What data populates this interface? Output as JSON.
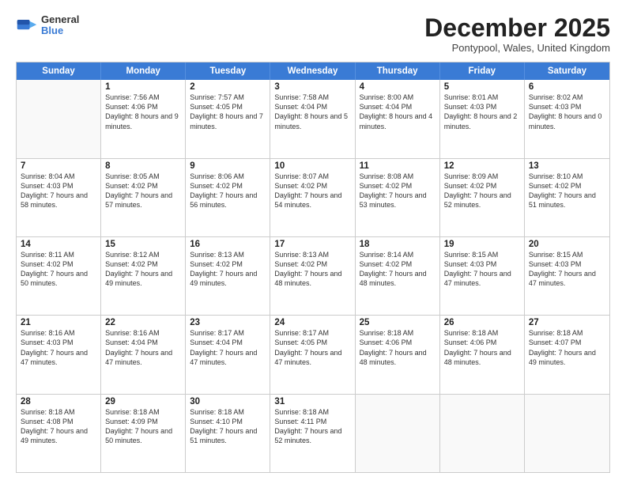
{
  "header": {
    "logo_general": "General",
    "logo_blue": "Blue",
    "month_title": "December 2025",
    "subtitle": "Pontypool, Wales, United Kingdom"
  },
  "day_headers": [
    "Sunday",
    "Monday",
    "Tuesday",
    "Wednesday",
    "Thursday",
    "Friday",
    "Saturday"
  ],
  "weeks": [
    [
      {
        "day": "",
        "info": ""
      },
      {
        "day": "1",
        "info": "Sunrise: 7:56 AM\nSunset: 4:06 PM\nDaylight: 8 hours\nand 9 minutes."
      },
      {
        "day": "2",
        "info": "Sunrise: 7:57 AM\nSunset: 4:05 PM\nDaylight: 8 hours\nand 7 minutes."
      },
      {
        "day": "3",
        "info": "Sunrise: 7:58 AM\nSunset: 4:04 PM\nDaylight: 8 hours\nand 5 minutes."
      },
      {
        "day": "4",
        "info": "Sunrise: 8:00 AM\nSunset: 4:04 PM\nDaylight: 8 hours\nand 4 minutes."
      },
      {
        "day": "5",
        "info": "Sunrise: 8:01 AM\nSunset: 4:03 PM\nDaylight: 8 hours\nand 2 minutes."
      },
      {
        "day": "6",
        "info": "Sunrise: 8:02 AM\nSunset: 4:03 PM\nDaylight: 8 hours\nand 0 minutes."
      }
    ],
    [
      {
        "day": "7",
        "info": "Sunrise: 8:04 AM\nSunset: 4:03 PM\nDaylight: 7 hours\nand 58 minutes."
      },
      {
        "day": "8",
        "info": "Sunrise: 8:05 AM\nSunset: 4:02 PM\nDaylight: 7 hours\nand 57 minutes."
      },
      {
        "day": "9",
        "info": "Sunrise: 8:06 AM\nSunset: 4:02 PM\nDaylight: 7 hours\nand 56 minutes."
      },
      {
        "day": "10",
        "info": "Sunrise: 8:07 AM\nSunset: 4:02 PM\nDaylight: 7 hours\nand 54 minutes."
      },
      {
        "day": "11",
        "info": "Sunrise: 8:08 AM\nSunset: 4:02 PM\nDaylight: 7 hours\nand 53 minutes."
      },
      {
        "day": "12",
        "info": "Sunrise: 8:09 AM\nSunset: 4:02 PM\nDaylight: 7 hours\nand 52 minutes."
      },
      {
        "day": "13",
        "info": "Sunrise: 8:10 AM\nSunset: 4:02 PM\nDaylight: 7 hours\nand 51 minutes."
      }
    ],
    [
      {
        "day": "14",
        "info": "Sunrise: 8:11 AM\nSunset: 4:02 PM\nDaylight: 7 hours\nand 50 minutes."
      },
      {
        "day": "15",
        "info": "Sunrise: 8:12 AM\nSunset: 4:02 PM\nDaylight: 7 hours\nand 49 minutes."
      },
      {
        "day": "16",
        "info": "Sunrise: 8:13 AM\nSunset: 4:02 PM\nDaylight: 7 hours\nand 49 minutes."
      },
      {
        "day": "17",
        "info": "Sunrise: 8:13 AM\nSunset: 4:02 PM\nDaylight: 7 hours\nand 48 minutes."
      },
      {
        "day": "18",
        "info": "Sunrise: 8:14 AM\nSunset: 4:02 PM\nDaylight: 7 hours\nand 48 minutes."
      },
      {
        "day": "19",
        "info": "Sunrise: 8:15 AM\nSunset: 4:03 PM\nDaylight: 7 hours\nand 47 minutes."
      },
      {
        "day": "20",
        "info": "Sunrise: 8:15 AM\nSunset: 4:03 PM\nDaylight: 7 hours\nand 47 minutes."
      }
    ],
    [
      {
        "day": "21",
        "info": "Sunrise: 8:16 AM\nSunset: 4:03 PM\nDaylight: 7 hours\nand 47 minutes."
      },
      {
        "day": "22",
        "info": "Sunrise: 8:16 AM\nSunset: 4:04 PM\nDaylight: 7 hours\nand 47 minutes."
      },
      {
        "day": "23",
        "info": "Sunrise: 8:17 AM\nSunset: 4:04 PM\nDaylight: 7 hours\nand 47 minutes."
      },
      {
        "day": "24",
        "info": "Sunrise: 8:17 AM\nSunset: 4:05 PM\nDaylight: 7 hours\nand 47 minutes."
      },
      {
        "day": "25",
        "info": "Sunrise: 8:18 AM\nSunset: 4:06 PM\nDaylight: 7 hours\nand 48 minutes."
      },
      {
        "day": "26",
        "info": "Sunrise: 8:18 AM\nSunset: 4:06 PM\nDaylight: 7 hours\nand 48 minutes."
      },
      {
        "day": "27",
        "info": "Sunrise: 8:18 AM\nSunset: 4:07 PM\nDaylight: 7 hours\nand 49 minutes."
      }
    ],
    [
      {
        "day": "28",
        "info": "Sunrise: 8:18 AM\nSunset: 4:08 PM\nDaylight: 7 hours\nand 49 minutes."
      },
      {
        "day": "29",
        "info": "Sunrise: 8:18 AM\nSunset: 4:09 PM\nDaylight: 7 hours\nand 50 minutes."
      },
      {
        "day": "30",
        "info": "Sunrise: 8:18 AM\nSunset: 4:10 PM\nDaylight: 7 hours\nand 51 minutes."
      },
      {
        "day": "31",
        "info": "Sunrise: 8:18 AM\nSunset: 4:11 PM\nDaylight: 7 hours\nand 52 minutes."
      },
      {
        "day": "",
        "info": ""
      },
      {
        "day": "",
        "info": ""
      },
      {
        "day": "",
        "info": ""
      }
    ]
  ]
}
